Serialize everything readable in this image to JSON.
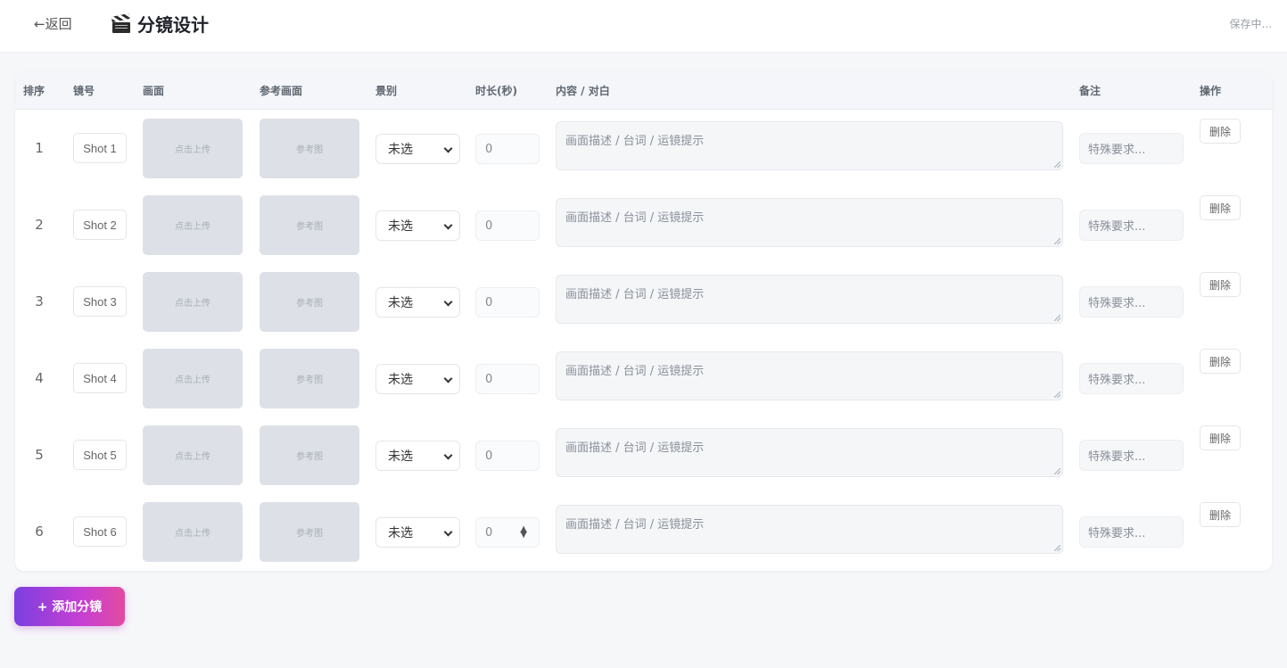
{
  "header": {
    "back_label": "←返回",
    "title": "分镜设计",
    "title_icon": "clapperboard-icon",
    "status": "保存中..."
  },
  "table": {
    "columns": [
      "排序",
      "镜号",
      "画面",
      "参考画面",
      "景别",
      "时长(秒)",
      "内容 / 对白",
      "备注",
      "操作"
    ],
    "rows": [
      {
        "order": "1",
        "shot": "Shot 1",
        "upload": "点击上传",
        "ref": "参考图",
        "scale": "未选",
        "duration": "0",
        "content_placeholder": "画面描述 / 台词 / 运镜提示",
        "note_placeholder": "特殊要求...",
        "action": "删除"
      },
      {
        "order": "2",
        "shot": "Shot 2",
        "upload": "点击上传",
        "ref": "参考图",
        "scale": "未选",
        "duration": "0",
        "content_placeholder": "画面描述 / 台词 / 运镜提示",
        "note_placeholder": "特殊要求...",
        "action": "删除"
      },
      {
        "order": "3",
        "shot": "Shot 3",
        "upload": "点击上传",
        "ref": "参考图",
        "scale": "未选",
        "duration": "0",
        "content_placeholder": "画面描述 / 台词 / 运镜提示",
        "note_placeholder": "特殊要求...",
        "action": "删除"
      },
      {
        "order": "4",
        "shot": "Shot 4",
        "upload": "点击上传",
        "ref": "参考图",
        "scale": "未选",
        "duration": "0",
        "content_placeholder": "画面描述 / 台词 / 运镜提示",
        "note_placeholder": "特殊要求...",
        "action": "删除"
      },
      {
        "order": "5",
        "shot": "Shot 5",
        "upload": "点击上传",
        "ref": "参考图",
        "scale": "未选",
        "duration": "0",
        "content_placeholder": "画面描述 / 台词 / 运镜提示",
        "note_placeholder": "特殊要求...",
        "action": "删除"
      },
      {
        "order": "6",
        "shot": "Shot 6",
        "upload": "点击上传",
        "ref": "参考图",
        "scale": "未选",
        "duration": "0",
        "content_placeholder": "画面描述 / 台词 / 运镜提示",
        "note_placeholder": "特殊要求...",
        "action": "删除"
      }
    ]
  },
  "add_button": "+ 添加分镜",
  "colors": {
    "accent_start": "#7b3fe0",
    "accent_end": "#e24aa0",
    "page_bg": "#f6f7f9",
    "upload_bg": "#dde1e7"
  }
}
